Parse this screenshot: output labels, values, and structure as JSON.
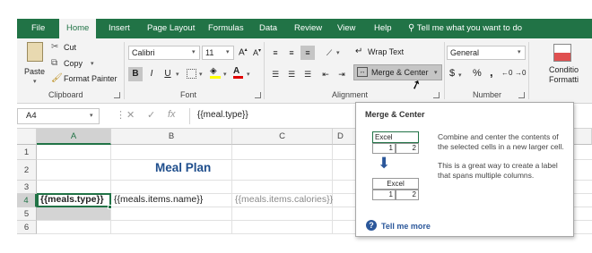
{
  "tabs": [
    "File",
    "Home",
    "Insert",
    "Page Layout",
    "Formulas",
    "Data",
    "Review",
    "View",
    "Help"
  ],
  "active_tab": "Home",
  "tell_me": "Tell me what you want to do",
  "clipboard": {
    "paste": "Paste",
    "cut": "Cut",
    "copy": "Copy",
    "format_painter": "Format Painter",
    "label": "Clipboard"
  },
  "font": {
    "name": "Calibri",
    "size": "11",
    "bold": "B",
    "italic": "I",
    "underline": "U",
    "label": "Font"
  },
  "alignment": {
    "wrap_text": "Wrap Text",
    "merge_center": "Merge & Center",
    "label": "Alignment"
  },
  "number": {
    "format": "General",
    "currency": "$",
    "percent": "%",
    "comma": ",",
    "label": "Number"
  },
  "styles": {
    "conditional": "Conditio",
    "formatting": "Formatti"
  },
  "formula_bar": {
    "name_box": "A4",
    "formula": "{{meal.type}}"
  },
  "columns": [
    "A",
    "B",
    "C",
    "D"
  ],
  "rows": [
    "1",
    "2",
    "3",
    "4",
    "5",
    "6"
  ],
  "cells": {
    "title": "Meal Plan",
    "a4": "{{meals.type}}",
    "b4": "{{meals.items.name}}",
    "c4": "{{meals.items.calories}}"
  },
  "tooltip": {
    "title": "Merge & Center",
    "desc1": "Combine and center the contents of the selected cells in a new larger cell.",
    "desc2": "This is a great way to create a label that spans multiple columns.",
    "illus_before": [
      "Excel",
      "1",
      "2"
    ],
    "illus_after": [
      "Excel",
      "1",
      "2"
    ],
    "link": "Tell me more"
  },
  "colors": {
    "accent": "#217346",
    "link": "#2b579a",
    "title": "#1f4e8c"
  }
}
